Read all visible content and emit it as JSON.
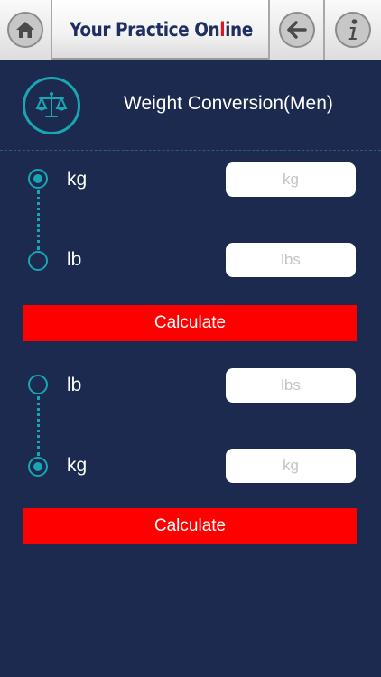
{
  "header": {
    "logo_text_pre": "Your Practice On",
    "logo_text_needle": "l",
    "logo_text_post": "ine",
    "home_icon": "home-icon",
    "back_icon": "back-arrow-icon",
    "info_icon": "info-icon"
  },
  "page": {
    "title": "Weight Conversion(Men)",
    "icon": "scale-icon"
  },
  "converters": [
    {
      "options": [
        {
          "label": "kg",
          "selected": true,
          "placeholder": "kg"
        },
        {
          "label": "lb",
          "selected": false,
          "placeholder": "lbs"
        }
      ],
      "button_label": "Calculate"
    },
    {
      "options": [
        {
          "label": "lb",
          "selected": false,
          "placeholder": "lbs"
        },
        {
          "label": "kg",
          "selected": true,
          "placeholder": "kg"
        }
      ],
      "button_label": "Calculate"
    }
  ],
  "colors": {
    "background": "#1b2a4e",
    "accent": "#19a5b2",
    "button": "#ff0000",
    "logo": "#1f2f63",
    "needle": "#d71920"
  }
}
